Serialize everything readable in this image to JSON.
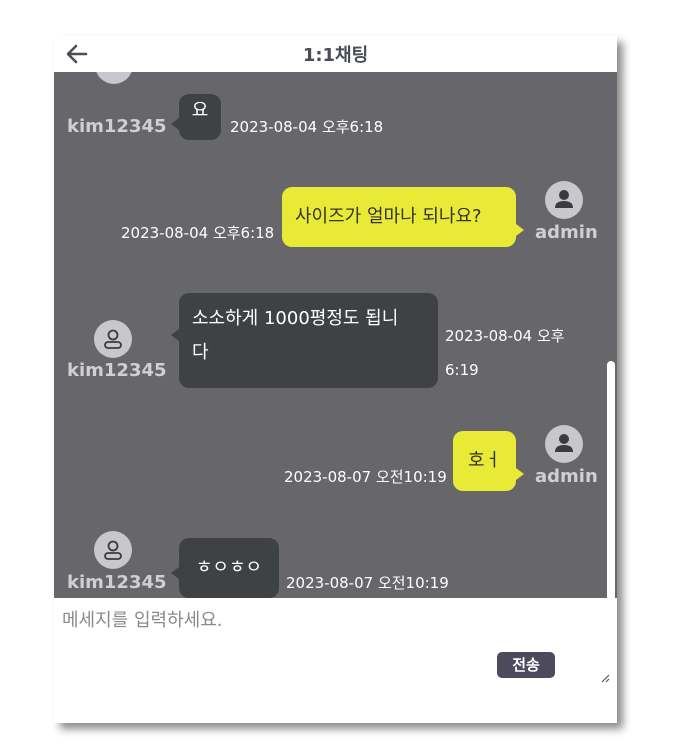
{
  "header": {
    "title": "1:1채팅",
    "back_icon": "arrow-left-icon"
  },
  "messages": [
    {
      "sender": "kim12345",
      "side": "left",
      "text": "요",
      "time": "2023-08-04 오후6:18"
    },
    {
      "sender": "admin",
      "side": "right",
      "text": "사이즈가 얼마나 되나요?",
      "time": "2023-08-04 오후6:18"
    },
    {
      "sender": "kim12345",
      "side": "left",
      "text_lines": [
        "소소하게 1000평정도 됩니",
        "다"
      ],
      "time_lines": [
        "2023-08-04 오후",
        "6:19"
      ]
    },
    {
      "sender": "admin",
      "side": "right",
      "text": "호ㅓ",
      "time": "2023-08-07 오전10:19"
    },
    {
      "sender": "kim12345",
      "side": "left",
      "text": "ㅎㅇㅎㅇ",
      "time": "2023-08-07 오전10:19"
    }
  ],
  "input": {
    "placeholder": "메세지를 입력하세요.",
    "value": ""
  },
  "send_button": {
    "label": "전송"
  },
  "colors": {
    "chat_bg": "#67666b",
    "dark_bubble": "#3f4244",
    "yellow_bubble": "#e9ea35",
    "send_bg": "#4e4a5e"
  }
}
